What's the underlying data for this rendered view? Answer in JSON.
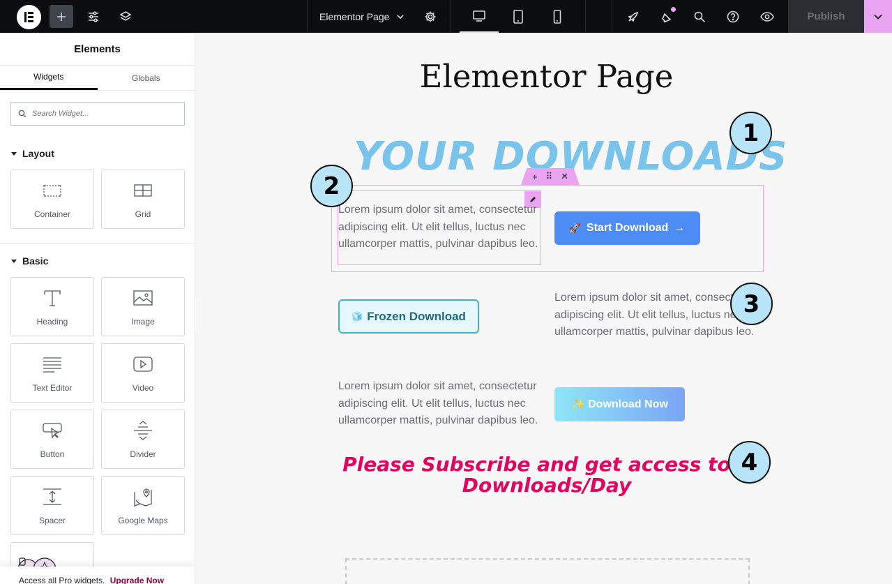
{
  "topbar": {
    "page_title": "Elementor Page",
    "publish_label": "Publish",
    "accent_color": "#e9a5f1"
  },
  "sidebar": {
    "title": "Elements",
    "tabs": [
      {
        "label": "Widgets",
        "active": true
      },
      {
        "label": "Globals",
        "active": false
      }
    ],
    "search_placeholder": "Search Widget...",
    "sections": [
      {
        "title": "Layout",
        "widgets": [
          {
            "label": "Container",
            "icon": "container-icon"
          },
          {
            "label": "Grid",
            "icon": "grid-icon"
          }
        ]
      },
      {
        "title": "Basic",
        "widgets": [
          {
            "label": "Heading",
            "icon": "heading-icon"
          },
          {
            "label": "Image",
            "icon": "image-icon"
          },
          {
            "label": "Text Editor",
            "icon": "text-editor-icon"
          },
          {
            "label": "Video",
            "icon": "video-icon"
          },
          {
            "label": "Button",
            "icon": "button-icon"
          },
          {
            "label": "Divider",
            "icon": "divider-icon"
          },
          {
            "label": "Spacer",
            "icon": "spacer-icon"
          },
          {
            "label": "Google Maps",
            "icon": "google-maps-icon"
          }
        ]
      }
    ],
    "pro_text": "Access all Pro widgets.",
    "upgrade_label": "Upgrade Now"
  },
  "canvas": {
    "page_heading": "Elementor Page",
    "downloads_title": "YOUR DOWNLOADS",
    "lorem": "Lorem ipsum dolor sit amet, consectetur adipiscing elit. Ut elit tellus, luctus nec ullamcorper mattis, pulvinar dapibus leo.",
    "buttons": {
      "start": {
        "emoji": "🚀",
        "label": "Start Download",
        "arrow": "→",
        "color": "#4d8bf5"
      },
      "frozen": {
        "emoji": "🧊",
        "label": "Frozen Download",
        "color": "#3fb2c4"
      },
      "now": {
        "emoji": "✨",
        "label": "Download Now"
      }
    },
    "subscribe_text": "Please Subscribe and get access to 4 Downloads/Day",
    "subscribe_color": "#e0045e",
    "title_color": "#7ac3ea"
  },
  "annotations": [
    "1",
    "2",
    "3",
    "4"
  ]
}
